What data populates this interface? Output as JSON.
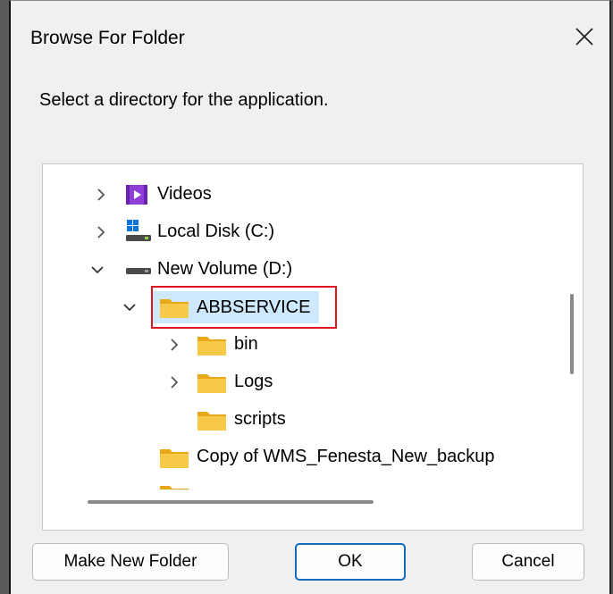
{
  "dialog": {
    "title": "Browse For Folder",
    "instruction": "Select a directory for the application."
  },
  "tree": {
    "items": [
      {
        "label": "Videos",
        "icon": "videos-icon"
      },
      {
        "label": "Local Disk (C:)",
        "icon": "local-disk-icon"
      },
      {
        "label": "New Volume (D:)",
        "icon": "drive-icon"
      },
      {
        "label": "ABBSERVICE",
        "icon": "folder-icon",
        "selected": true
      },
      {
        "label": "bin",
        "icon": "folder-icon"
      },
      {
        "label": "Logs",
        "icon": "folder-icon"
      },
      {
        "label": "scripts",
        "icon": "folder-icon"
      },
      {
        "label": "Copy of WMS_Fenesta_New_backup",
        "icon": "folder-icon"
      }
    ]
  },
  "buttons": {
    "make_new_folder": "Make New Folder",
    "ok": "OK",
    "cancel": "Cancel"
  },
  "colors": {
    "highlight_border": "#e0141e",
    "selection": "#cde8ff",
    "folder": "#f7c948",
    "accent": "#0f6cbd"
  }
}
